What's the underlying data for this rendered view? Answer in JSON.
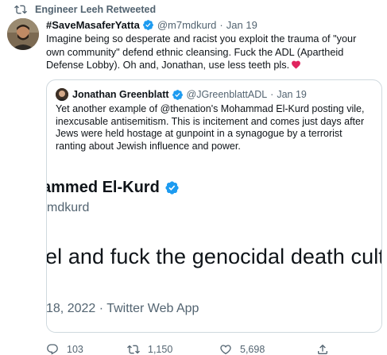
{
  "retweet_context": {
    "label": "Engineer Leeh Retweeted",
    "icon": "retweet-icon"
  },
  "tweet": {
    "display_name": "#SaveMasaferYatta",
    "handle": "@m7mdkurd",
    "separator": "·",
    "time": "Jan 19",
    "text": "Imagine being so desperate and racist you exploit the trauma of \"your own community\" defend ethnic cleansing. Fuck the ADL (Apartheid Defense Lobby). Oh and, Jonathan, use less teeth pls.",
    "emoji": "red-heart",
    "verified_color": "#1d9bf0",
    "heart_color": "#e0245e"
  },
  "quote": {
    "display_name": "Jonathan Greenblatt",
    "handle": "@JGreenblattADL",
    "separator": "·",
    "time": "Jan 19",
    "text": "Yet another example of @thenation's Mohammad El-Kurd posting vile, inexcusable antisemitism. This is incitement and comes just days after Jews were held hostage at gunpoint in a synagogue by a terrorist ranting about Jewish influence and power.",
    "embedded_image": {
      "name_fragment": "ammed El-Kurd",
      "handle_fragment": "mdkurd",
      "text_fragment": "el and fuck the genocidal death cult t",
      "date_fragment": "18, 2022 · Twitter Web App"
    }
  },
  "actions": {
    "reply_count": "103",
    "retweet_count": "1,150",
    "like_count": "5,698"
  }
}
